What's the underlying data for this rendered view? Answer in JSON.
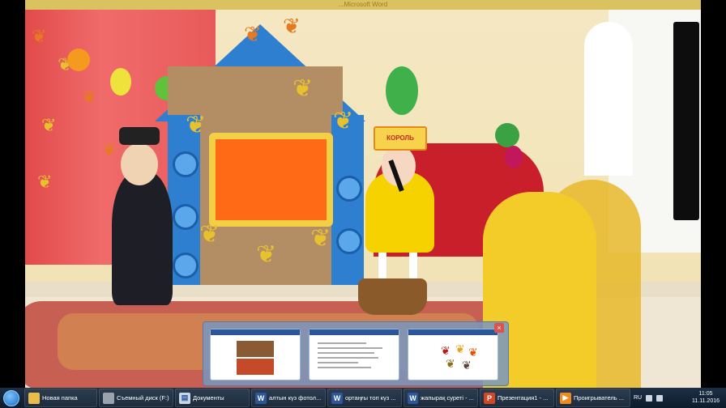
{
  "window_title": "...Microsoft Word",
  "scene": {
    "hat_text": "КОРОЛЬ"
  },
  "thumbnails": [
    {
      "name": "photo-preview"
    },
    {
      "name": "word-doc-preview"
    },
    {
      "name": "leaves-preview"
    }
  ],
  "taskbar": {
    "items": [
      {
        "label": "Новая папка",
        "icon": "folder-icon"
      },
      {
        "label": "Съемный диск (F:)",
        "icon": "drive-icon"
      },
      {
        "label": "Документы",
        "icon": "documents-icon"
      },
      {
        "label": "алтын күз фотол...",
        "icon": "word-icon"
      },
      {
        "label": "ортаңғы топ күз ...",
        "icon": "word-icon"
      },
      {
        "label": "жапырақ суреті - ...",
        "icon": "word-icon"
      },
      {
        "label": "Презентация1 - ...",
        "icon": "powerpoint-icon"
      },
      {
        "label": "Проигрыватель ...",
        "icon": "media-player-icon"
      }
    ],
    "tray": {
      "language": "RU",
      "time": "11:05",
      "date": "11.11.2016"
    }
  }
}
